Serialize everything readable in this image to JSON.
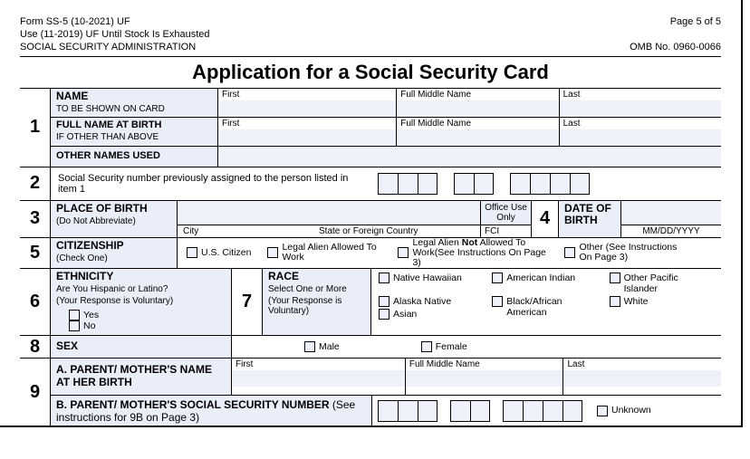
{
  "header": {
    "form_line": "Form SS-5 (10-2021) UF",
    "stock_line": "Use (11-2019) UF Until Stock Is Exhausted",
    "agency": "SOCIAL SECURITY ADMINISTRATION",
    "page": "Page 5 of 5",
    "omb": "OMB No. 0960-0066"
  },
  "title": "Application for a Social Security Card",
  "s1": {
    "num": "1",
    "name_lbl": "NAME",
    "name_sub": "TO BE SHOWN ON CARD",
    "birth_lbl": "FULL NAME AT BIRTH",
    "birth_sub": "IF OTHER THAN ABOVE",
    "other_lbl": "OTHER NAMES USED",
    "first": "First",
    "middle": "Full Middle Name",
    "last": "Last"
  },
  "s2": {
    "num": "2",
    "text": "Social Security number previously assigned to the person listed in item 1"
  },
  "s3": {
    "num": "3",
    "lbl": "PLACE OF BIRTH",
    "sub": "(Do Not Abbreviate)",
    "city": "City",
    "state": "State or Foreign Country",
    "office": "Office Use Only",
    "fci": "FCI"
  },
  "s4": {
    "num": "4",
    "lbl": "DATE OF BIRTH",
    "fmt": "MM/DD/YYYY"
  },
  "s5": {
    "num": "5",
    "lbl": "CITIZENSHIP",
    "sub": "(Check One)",
    "o1": "U.S. Citizen",
    "o2": "Legal Alien Allowed To Work",
    "o3_a": "Legal Alien ",
    "o3_b": "Not",
    "o3_c": " Allowed To Work(See Instructions On Page 3)",
    "o4": "Other (See Instructions On Page 3)"
  },
  "s6": {
    "num": "6",
    "lbl": "ETHNICITY",
    "q": "Are You Hispanic or Latino?",
    "vol": "(Your Response is Voluntary)",
    "yes": "Yes",
    "no": "No"
  },
  "s7": {
    "num": "7",
    "lbl": "RACE",
    "q": "Select One or More",
    "vol": "(Your Response is Voluntary)",
    "o1": "Native Hawaiian",
    "o2": "American Indian",
    "o3": "Other Pacific Islander",
    "o4": "Alaska Native",
    "o5": "Black/African American",
    "o6": "White",
    "o7": "Asian"
  },
  "s8": {
    "num": "8",
    "lbl": "SEX",
    "m": "Male",
    "f": "Female"
  },
  "s9": {
    "num": "9",
    "a_lbl": "A. PARENT/ MOTHER'S NAME  AT HER BIRTH",
    "b_lbl_1": "B. PARENT/ MOTHER'S SOCIAL SECURITY NUMBER",
    "b_lbl_2": " (See instructions for 9B on Page 3)",
    "first": "First",
    "middle": "Full Middle Name",
    "last": "Last",
    "unknown": "Unknown"
  }
}
